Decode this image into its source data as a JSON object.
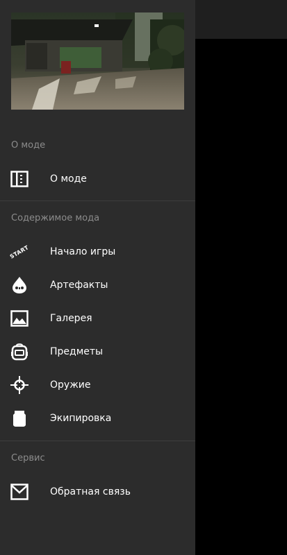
{
  "drawer": {
    "sections": [
      {
        "title": "О моде"
      },
      {
        "title": "Содержимое мода"
      },
      {
        "title": "Сервис"
      }
    ],
    "items": [
      {
        "label": "О моде",
        "icon": "book-icon"
      },
      {
        "label": "Начало игры",
        "icon": "start-icon",
        "icon_text": "START"
      },
      {
        "label": "Артефакты",
        "icon": "artifact-icon"
      },
      {
        "label": "Галерея",
        "icon": "gallery-icon"
      },
      {
        "label": "Предметы",
        "icon": "backpack-icon"
      },
      {
        "label": "Оружие",
        "icon": "crosshair-icon"
      },
      {
        "label": "Экипировка",
        "icon": "armor-icon"
      },
      {
        "label": "Обратная связь",
        "icon": "mail-icon"
      }
    ]
  },
  "colors": {
    "drawer_bg": "#2c2c2c",
    "text_primary": "#ffffff",
    "text_secondary": "#8c8c8c",
    "divider": "#3d3d3d",
    "scrim": "#000000"
  }
}
